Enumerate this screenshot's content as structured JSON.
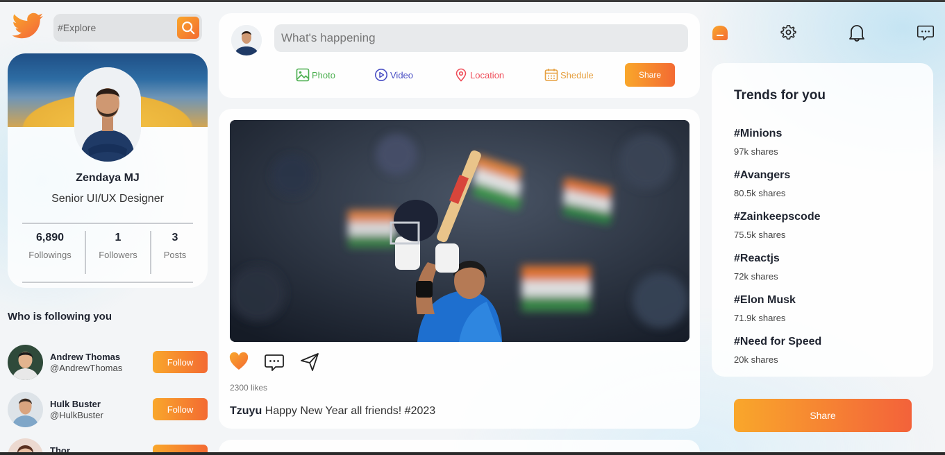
{
  "search": {
    "placeholder": "#Explore"
  },
  "profile": {
    "name": "Zendaya MJ",
    "role": "Senior UI/UX Designer",
    "stats": [
      {
        "value": "6,890",
        "label": "Followings"
      },
      {
        "value": "1",
        "label": "Followers"
      },
      {
        "value": "3",
        "label": "Posts"
      }
    ]
  },
  "followers": {
    "title": "Who is following you",
    "items": [
      {
        "name": "Andrew Thomas",
        "handle": "@AndrewThomas",
        "button": "Follow"
      },
      {
        "name": "Hulk Buster",
        "handle": "@HulkBuster",
        "button": "Follow"
      },
      {
        "name": "Thor",
        "handle": "",
        "button": "Follow"
      }
    ]
  },
  "composer": {
    "placeholder": "What's happening",
    "options": [
      {
        "label": "Photo",
        "icon": "photo-icon",
        "color": "#4caf50"
      },
      {
        "label": "Video",
        "icon": "video-icon",
        "color": "#4a4fc4"
      },
      {
        "label": "Location",
        "icon": "location-icon",
        "color": "#ef4e5a"
      },
      {
        "label": "Shedule",
        "icon": "calendar-icon",
        "color": "#e6a040"
      }
    ],
    "share_label": "Share"
  },
  "post": {
    "likes": "2300 likes",
    "author": "Tzuyu",
    "text": "Happy New Year all friends! #2023"
  },
  "trends": {
    "title": "Trends for you",
    "items": [
      {
        "tag": "#Minions",
        "shares": "97k shares"
      },
      {
        "tag": "#Avangers",
        "shares": "80.5k shares"
      },
      {
        "tag": "#Zainkeepscode",
        "shares": "75.5k shares"
      },
      {
        "tag": "#Reactjs",
        "shares": "72k shares"
      },
      {
        "tag": "#Elon Musk",
        "shares": "71.9k shares"
      },
      {
        "tag": "#Need for Speed",
        "shares": "20k shares"
      }
    ]
  },
  "share_label": "Share",
  "colors": {
    "accent": "#f47b30",
    "accent_light": "#f9a72b"
  }
}
